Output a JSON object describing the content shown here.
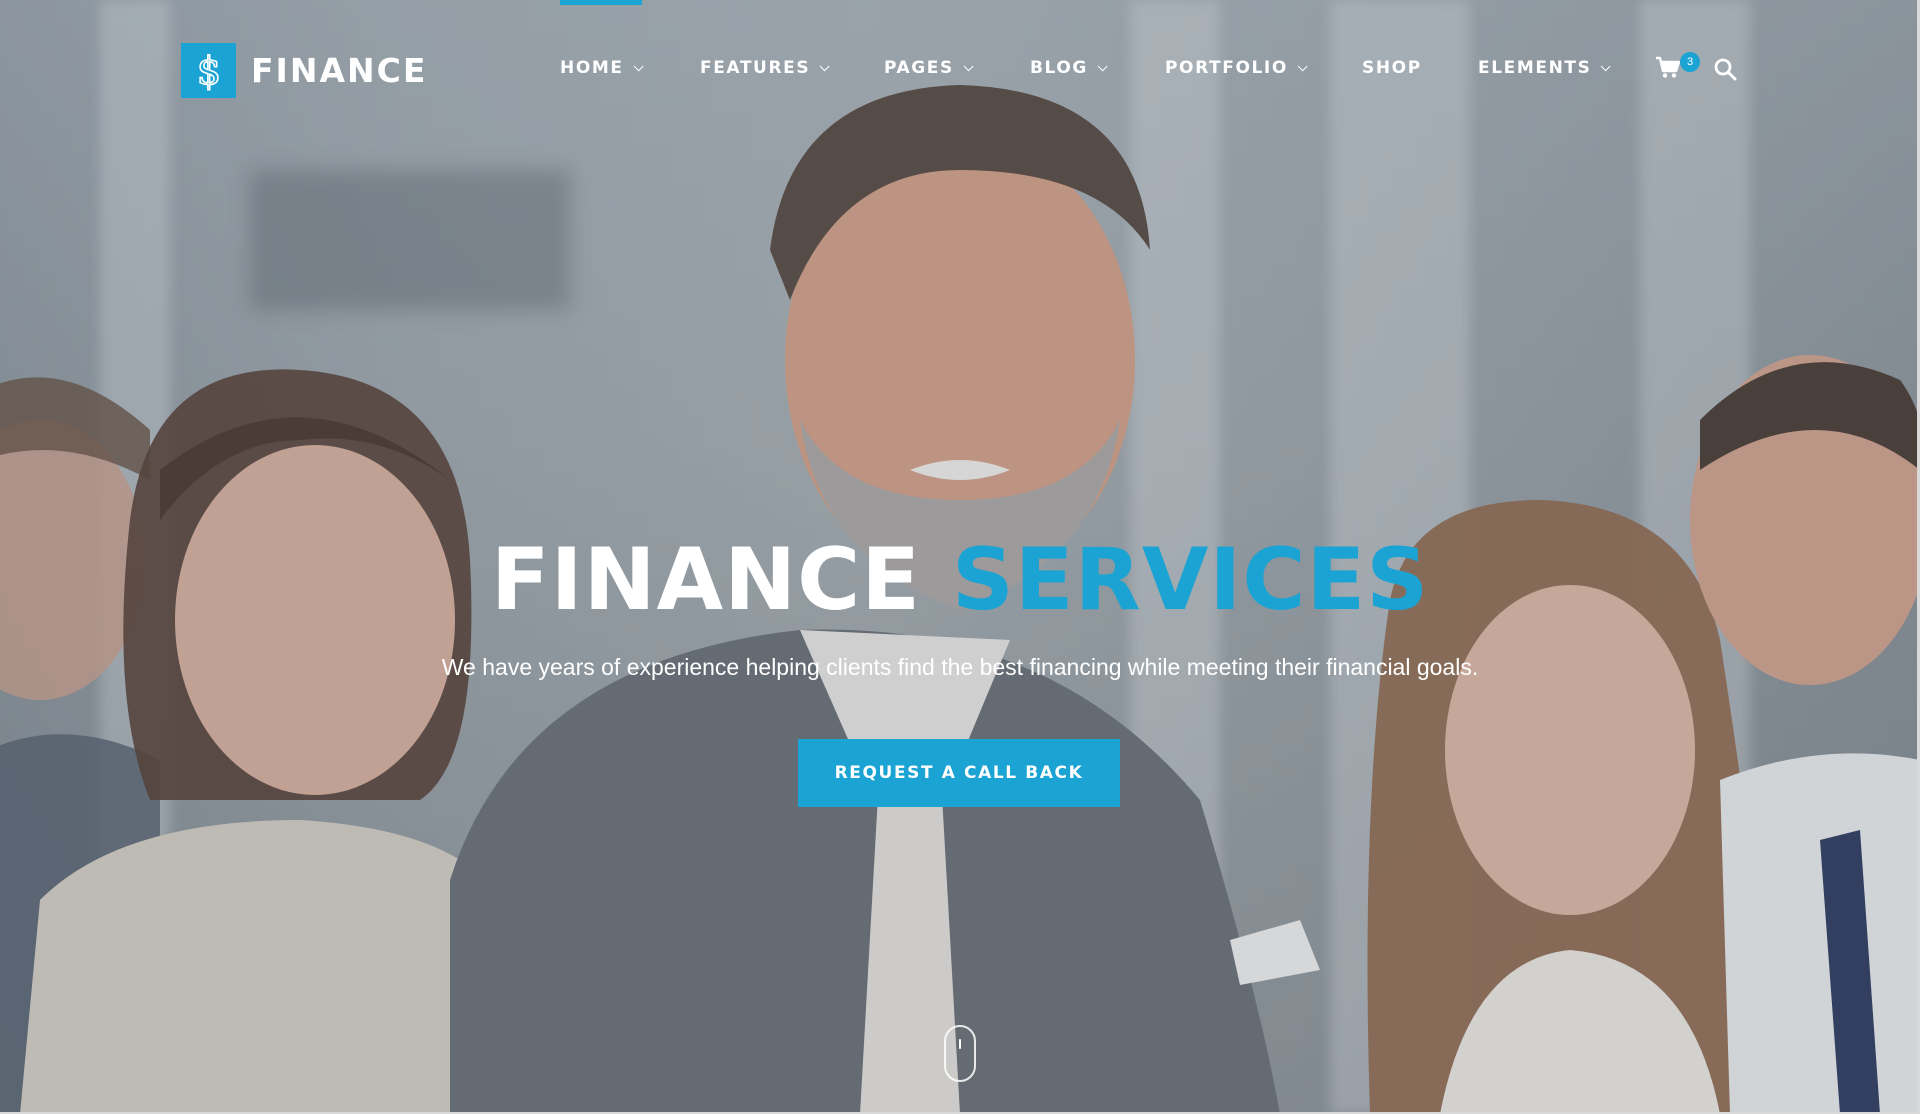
{
  "brand": {
    "name": "FINANCE",
    "logo_icon": "dollar-sign-icon",
    "accent_color": "#1ba3d3"
  },
  "nav": {
    "items": [
      {
        "label": "HOME",
        "has_dropdown": true
      },
      {
        "label": "FEATURES",
        "has_dropdown": true
      },
      {
        "label": "PAGES",
        "has_dropdown": true
      },
      {
        "label": "BLOG",
        "has_dropdown": true
      },
      {
        "label": "PORTFOLIO",
        "has_dropdown": true
      },
      {
        "label": "SHOP",
        "has_dropdown": false
      },
      {
        "label": "ELEMENTS",
        "has_dropdown": true
      }
    ],
    "cart_icon": "shopping-cart-icon",
    "cart_count": "3",
    "search_icon": "search-icon"
  },
  "hero": {
    "title_part1": "FINANCE",
    "title_part2": "SERVICES",
    "subtitle": "We have years of experience helping clients find the best financing while meeting their financial goals.",
    "cta_label": "REQUEST A CALL BACK",
    "scroll_icon": "mouse-scroll-icon"
  }
}
